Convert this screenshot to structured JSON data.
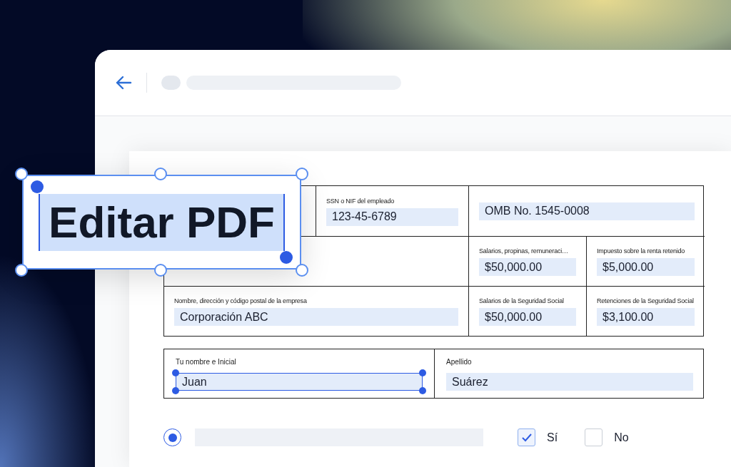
{
  "overlay": {
    "text": "Editar PDF",
    "selected": true
  },
  "form": {
    "employee_id": {
      "label": "SSN o NIF del empleado",
      "value": "123-45-6789"
    },
    "omb_number": {
      "value": "OMB No. 1545-0008"
    },
    "wages": {
      "label": "Salarios, propinas,  remuneraci…",
      "value": "$50,000.00"
    },
    "income_tax": {
      "label": "Impuesto sobre la renta retenido",
      "value": "$5,000.00"
    },
    "employer": {
      "label": "Nombre, dirección y código postal de la empresa",
      "value": "Corporación ABC"
    },
    "ss_wages": {
      "label": "Salarios de la Seguridad Social",
      "value": "$50,000.00"
    },
    "ss_tax": {
      "label": "Retenciones de la Seguridad Social",
      "value": "$3,100.00"
    }
  },
  "name_fields": [
    {
      "label": "Tu nombre e Inicial",
      "value": "Juan",
      "selected": true
    },
    {
      "label": "Apellido",
      "value": "Suárez",
      "selected": false
    }
  ],
  "radio": {
    "selected": true
  },
  "checkboxes": [
    {
      "label": "Sí",
      "checked": true
    },
    {
      "label": "No",
      "checked": false
    }
  ]
}
